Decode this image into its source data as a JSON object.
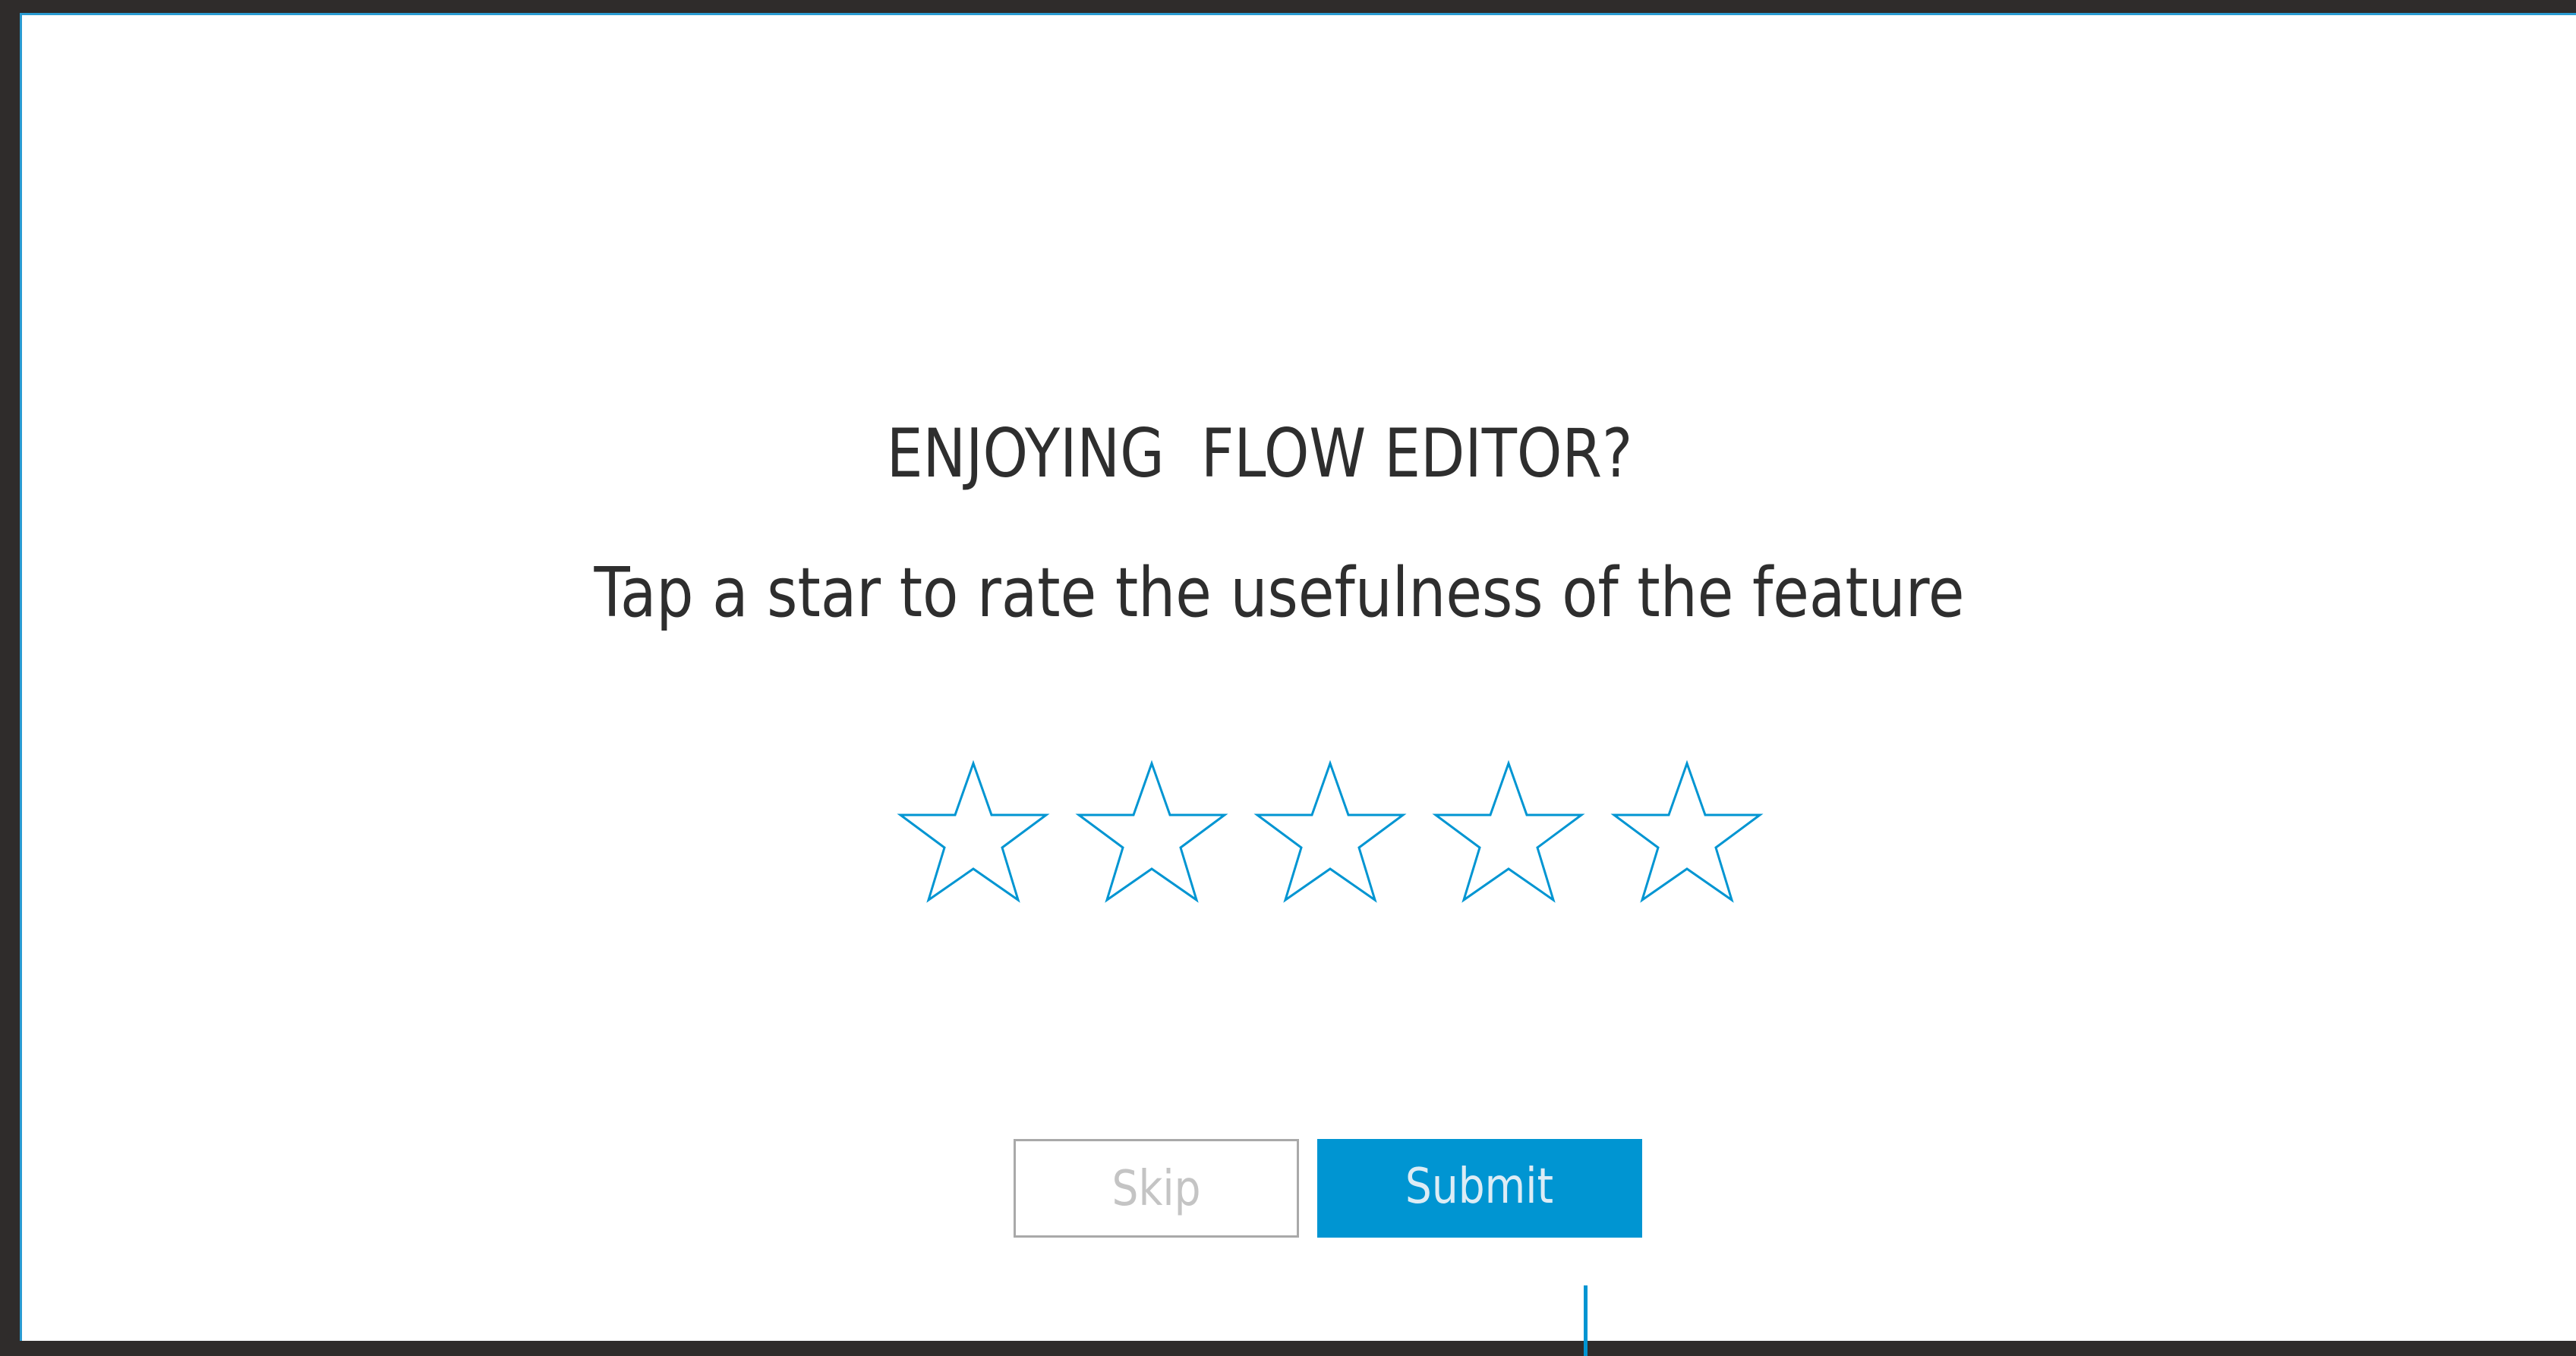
{
  "dialog": {
    "title": "ENJOYING  FLOW EDITOR?",
    "subtitle": "Tap a star to rate the usefulness of the feature"
  },
  "rating": {
    "max_stars": 5,
    "selected": 0,
    "star_icon": "star-outline-icon",
    "star_color": "#0095d2"
  },
  "buttons": {
    "skip_label": "Skip",
    "submit_label": "Submit"
  },
  "colors": {
    "accent": "#0095d2",
    "text": "#2e2e2e",
    "skip_text": "#c4c4c4",
    "skip_border": "#a9a9a9",
    "background": "#ffffff",
    "outer": "#2f2c2b"
  }
}
